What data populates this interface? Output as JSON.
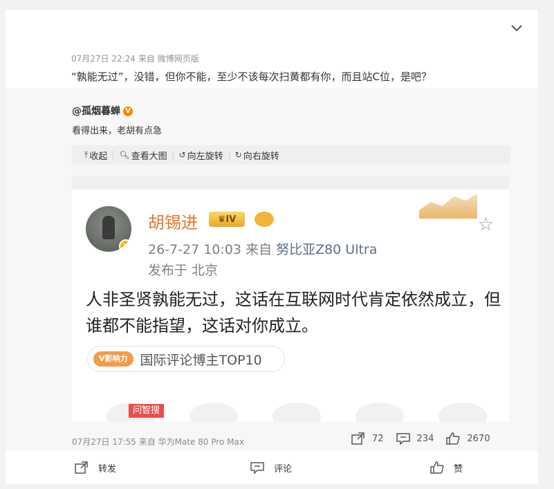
{
  "post": {
    "meta": "07月27日 22:24  来自 微博网页版",
    "text": "“孰能无过”，没错，但你不能，至少不该每次扫黄都有你，而且站C位，是吧？"
  },
  "repost": {
    "author": "@孤烟暮蝉",
    "text": "看得出来，老胡有点急",
    "toolbar": {
      "collapse": "收起",
      "view_large": "查看大图",
      "rotate_left": "向左旋转",
      "rotate_right": "向右旋转"
    },
    "screenshot": {
      "name": "胡锡进",
      "level": "IV",
      "time": "26-7-27 10:03",
      "from": "来自",
      "device": "努比亚Z80 Ultra",
      "location": "发布于 北京",
      "body": "人非圣贤孰能无过，这话在互联网时代肯定依然成立，但谁都不能指望，这话对你成立。",
      "influence_badge": "V影响力",
      "tag": "国际评论博主TOP10",
      "search_badge": "问智搜"
    },
    "bottom_meta": "07月27日 17:55  来自 华为Mate 80 Pro Max",
    "stats": {
      "reposts": "72",
      "comments": "234",
      "likes": "2670"
    }
  },
  "actions": {
    "repost": "转发",
    "comment": "评论",
    "like": "赞"
  },
  "colors": {
    "accent_orange": "#ff8200",
    "name_orange": "#e0762b",
    "device_blue": "#5f6f86"
  }
}
